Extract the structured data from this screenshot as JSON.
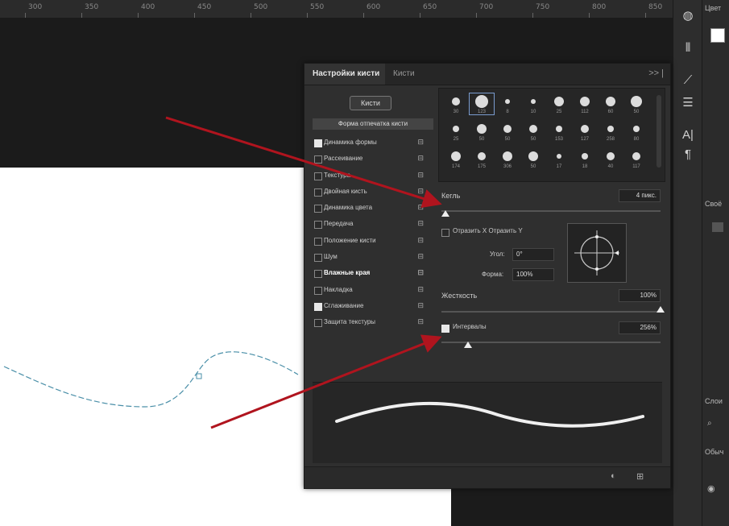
{
  "ruler": {
    "ticks": [
      "300",
      "350",
      "400",
      "450",
      "500",
      "550",
      "600",
      "650",
      "700",
      "750",
      "800",
      "850"
    ]
  },
  "panel": {
    "tab_active": "Настройки кисти",
    "tab_inactive": "Кисти",
    "menu_icon": ">> |",
    "brushes_button": "Кисти",
    "list_header": "Форма отпечатка кисти",
    "items": [
      {
        "label": "Динамика формы",
        "checked": true
      },
      {
        "label": "Рассеивание",
        "checked": false
      },
      {
        "label": "Текстура",
        "checked": false
      },
      {
        "label": "Двойная кисть",
        "checked": false
      },
      {
        "label": "Динамика цвета",
        "checked": false
      },
      {
        "label": "Передача",
        "checked": false
      },
      {
        "label": "Положение кисти",
        "checked": false
      },
      {
        "label": "Шум",
        "checked": false
      },
      {
        "label": "Влажные края",
        "checked": false
      },
      {
        "label": "Накладка",
        "checked": false
      },
      {
        "label": "Сглаживание",
        "checked": true
      },
      {
        "label": "Защита текстуры",
        "checked": false
      }
    ],
    "brush_grid": [
      {
        "num": "30",
        "size": 10
      },
      {
        "num": "123",
        "size": 16
      },
      {
        "num": "8",
        "size": 6
      },
      {
        "num": "10",
        "size": 6
      },
      {
        "num": "25",
        "size": 12
      },
      {
        "num": "112",
        "size": 12
      },
      {
        "num": "60",
        "size": 12
      },
      {
        "num": "50",
        "size": 14
      },
      {
        "num": "25",
        "size": 8
      },
      {
        "num": "50",
        "size": 12
      },
      {
        "num": "50",
        "size": 10
      },
      {
        "num": "50",
        "size": 10
      },
      {
        "num": "153",
        "size": 8
      },
      {
        "num": "127",
        "size": 10
      },
      {
        "num": "258",
        "size": 8
      },
      {
        "num": "80",
        "size": 8
      },
      {
        "num": "174",
        "size": 12
      },
      {
        "num": "175",
        "size": 10
      },
      {
        "num": "306",
        "size": 12
      },
      {
        "num": "50",
        "size": 12
      },
      {
        "num": "17",
        "size": 6
      },
      {
        "num": "18",
        "size": 8
      },
      {
        "num": "40",
        "size": 10
      },
      {
        "num": "117",
        "size": 10
      }
    ],
    "size_label": "Кегль",
    "size_value": "4 пикс.",
    "flip_label": "Отразить X   Отразить Y",
    "angle_label": "Угол:",
    "angle_value": "0°",
    "roundness_label": "Форма:",
    "roundness_value": "100%",
    "hardness_label": "Жесткость",
    "hardness_value": "100%",
    "hardness_fraction": 1.0,
    "spacing_label": "Интервалы",
    "spacing_value": "256%",
    "spacing_checked": true
  },
  "toolbar": {
    "icons": [
      "color-wheel-icon",
      "brush-icon",
      "brush-settings-icon",
      "adjust-icon",
      "type-icon",
      "paragraph-icon"
    ]
  },
  "right_panel": {
    "texts": [
      "Цвет",
      "Своё",
      "Слои",
      "Обыч"
    ]
  },
  "colors": {
    "arrow": "#b0141e",
    "path": "#4a8fa8"
  }
}
